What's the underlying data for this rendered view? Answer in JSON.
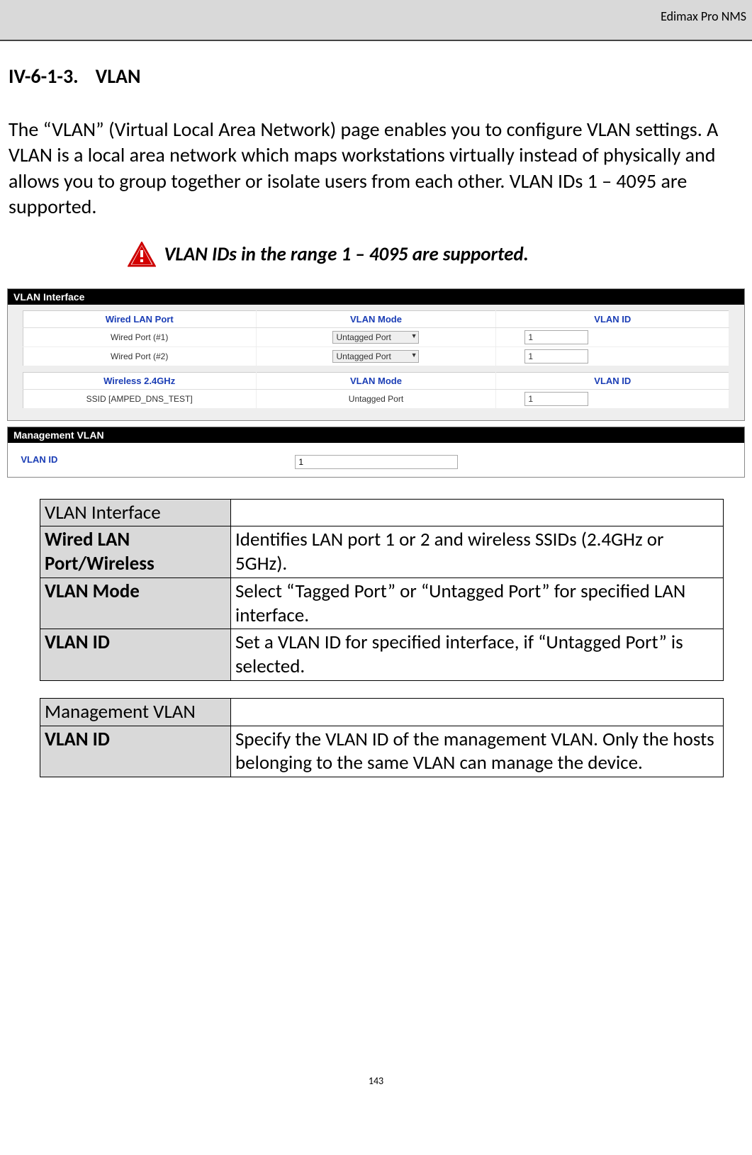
{
  "header": {
    "product": "Edimax Pro NMS"
  },
  "section": {
    "number": "IV-6-1-3.",
    "title": "VLAN"
  },
  "intro": "The “VLAN” (Virtual Local Area Network) page enables you to configure VLAN settings. A VLAN is a local area network which maps workstations virtually instead of physically and allows you to group together or isolate users from each other. VLAN IDs 1 – 4095 are supported.",
  "warning": "VLAN IDs in the range 1 – 4095 are supported.",
  "vlan_interface_panel": {
    "title": "VLAN Interface",
    "wired_headers": {
      "c1": "Wired LAN Port",
      "c2": "VLAN Mode",
      "c3": "VLAN ID"
    },
    "wired_rows": [
      {
        "port": "Wired Port (#1)",
        "mode": "Untagged Port",
        "id": "1"
      },
      {
        "port": "Wired Port (#2)",
        "mode": "Untagged Port",
        "id": "1"
      }
    ],
    "wireless_headers": {
      "c1": "Wireless 2.4GHz",
      "c2": "VLAN Mode",
      "c3": "VLAN ID"
    },
    "wireless_rows": [
      {
        "ssid": "SSID [AMPED_DNS_TEST]",
        "mode": "Untagged Port",
        "id": "1"
      }
    ]
  },
  "mgmt_panel": {
    "title": "Management VLAN",
    "label": "VLAN ID",
    "value": "1"
  },
  "desc_vlan": {
    "header": "VLAN Interface",
    "rows": [
      {
        "k": "Wired LAN Port/Wireless",
        "v": "Identifies LAN port 1 or 2 and wireless SSIDs (2.4GHz or 5GHz)."
      },
      {
        "k": "VLAN Mode",
        "v": "Select “Tagged Port” or “Untagged Port” for specified LAN interface."
      },
      {
        "k": "VLAN ID",
        "v": "Set a VLAN ID for specified interface, if “Untagged Port” is selected."
      }
    ]
  },
  "desc_mgmt": {
    "header": "Management VLAN",
    "rows": [
      {
        "k": "VLAN ID",
        "v": "Specify the VLAN ID of the management VLAN. Only the hosts belonging to the same VLAN can manage the device."
      }
    ]
  },
  "page_number": "143"
}
